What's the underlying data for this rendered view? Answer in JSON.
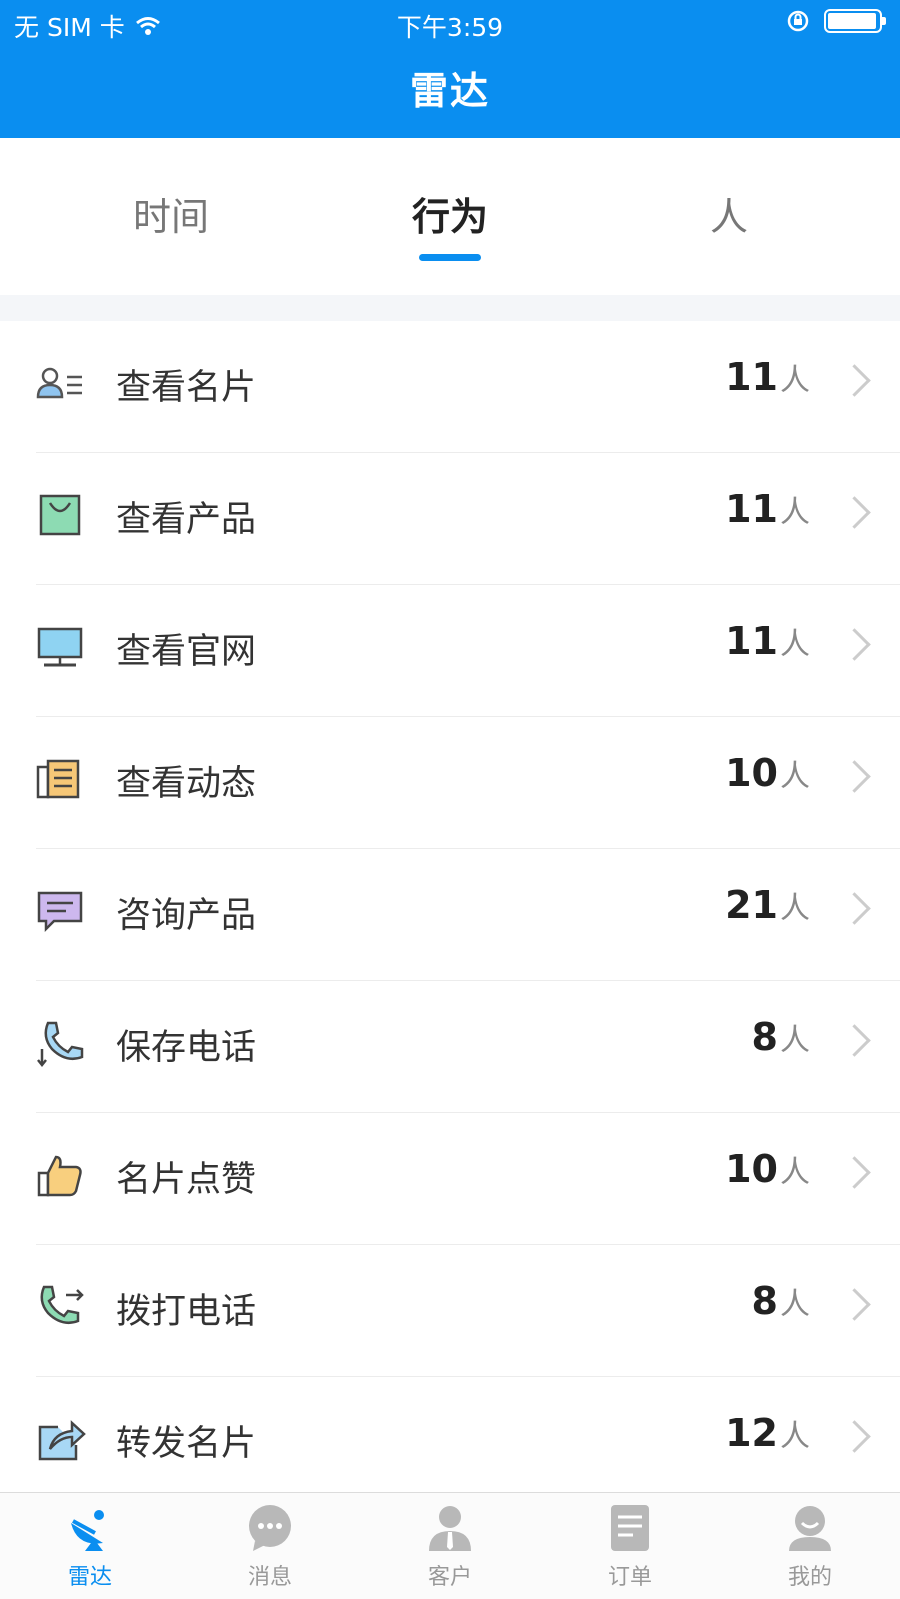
{
  "status_bar": {
    "carrier": "无 SIM 卡",
    "time": "下午3:59"
  },
  "header": {
    "title": "雷达"
  },
  "tabs": [
    {
      "label": "时间",
      "active": false
    },
    {
      "label": "行为",
      "active": true
    },
    {
      "label": "人",
      "active": false
    }
  ],
  "rows": [
    {
      "label": "查看名片",
      "count": "11",
      "unit": "人",
      "icon": "contact-card-icon"
    },
    {
      "label": "查看产品",
      "count": "11",
      "unit": "人",
      "icon": "shopping-bag-icon"
    },
    {
      "label": "查看官网",
      "count": "11",
      "unit": "人",
      "icon": "monitor-icon"
    },
    {
      "label": "查看动态",
      "count": "10",
      "unit": "人",
      "icon": "news-icon"
    },
    {
      "label": "咨询产品",
      "count": "21",
      "unit": "人",
      "icon": "chat-bubble-icon"
    },
    {
      "label": "保存电话",
      "count": "8",
      "unit": "人",
      "icon": "phone-save-icon"
    },
    {
      "label": "名片点赞",
      "count": "10",
      "unit": "人",
      "icon": "thumbs-up-icon"
    },
    {
      "label": "拨打电话",
      "count": "8",
      "unit": "人",
      "icon": "phone-call-icon"
    },
    {
      "label": "转发名片",
      "count": "12",
      "unit": "人",
      "icon": "share-icon"
    }
  ],
  "tabbar": [
    {
      "label": "雷达",
      "active": true,
      "icon": "radar-icon"
    },
    {
      "label": "消息",
      "active": false,
      "icon": "message-icon"
    },
    {
      "label": "客户",
      "active": false,
      "icon": "customer-icon"
    },
    {
      "label": "订单",
      "active": false,
      "icon": "order-icon"
    },
    {
      "label": "我的",
      "active": false,
      "icon": "profile-icon"
    }
  ],
  "colors": {
    "accent": "#0a8ef0",
    "tab_inactive": "#999999"
  }
}
